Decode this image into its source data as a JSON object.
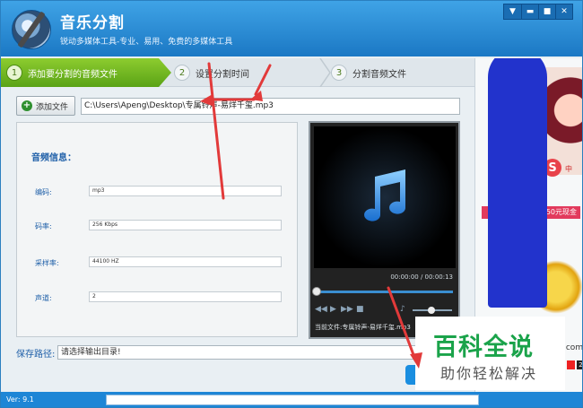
{
  "app": {
    "title": "音乐分割",
    "subtitle": "锐动多媒体工具-专业、易用、免费的多媒体工具"
  },
  "window_controls": {
    "menu_icon": "menu-icon",
    "minimize_icon": "minimize-icon",
    "maximize_icon": "maximize-icon",
    "close_icon": "close-icon"
  },
  "steps": [
    {
      "num": "1",
      "label": "添加要分割的音频文件",
      "active": true
    },
    {
      "num": "2",
      "label": "设置分割时间",
      "active": false
    },
    {
      "num": "3",
      "label": "分割音频文件",
      "active": false
    }
  ],
  "add_file": {
    "label": "添加文件",
    "path": "C:\\Users\\Apeng\\Desktop\\专属铃声-易烊千玺.mp3"
  },
  "audio_info": {
    "heading": "音频信息：",
    "fields": [
      {
        "label": "编码:",
        "value": "mp3"
      },
      {
        "label": "码率:",
        "value": "256 Kbps"
      },
      {
        "label": "采样率:",
        "value": "44100 HZ"
      },
      {
        "label": "声道:",
        "value": "2"
      }
    ]
  },
  "player": {
    "time": "00:00:00 / 00:00:13",
    "progress": 0,
    "current_file_label": "当前文件:专属铃声-易烊千玺.mp3",
    "volume": 0.6
  },
  "save": {
    "label": "保存路径:",
    "value": "请选择输出目录!"
  },
  "status": {
    "version": "Ver: 9.1"
  },
  "ad": {
    "s_letter": "S",
    "zhong": "中",
    "cash": "50元现金",
    "com": ".com",
    "page": "2"
  },
  "watermark": {
    "title": "百科全说",
    "subtitle": "助你轻松解决"
  },
  "colors": {
    "title_bar": "#1b78c4",
    "active_step": "#5aa316",
    "label_blue": "#1e5fa8",
    "annotation_red": "#e23a3a",
    "redaction_blue": "#2233cc",
    "watermark_green": "#1aa34a"
  }
}
